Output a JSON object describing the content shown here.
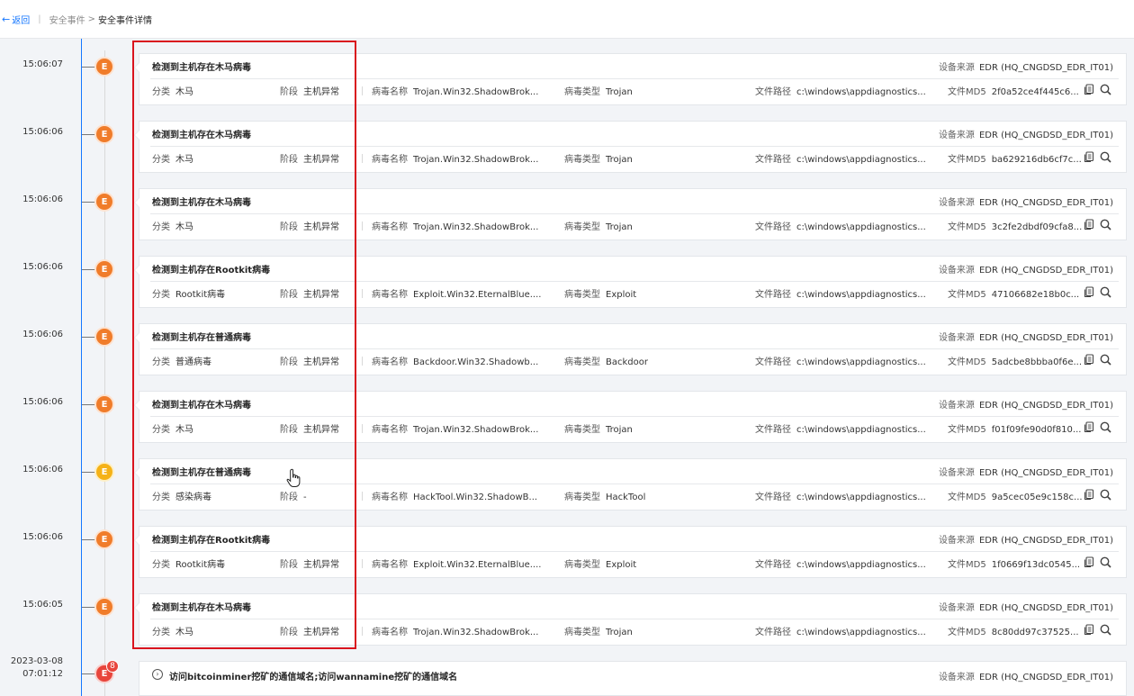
{
  "header": {
    "back_label": "返回",
    "crumb_parent": "安全事件",
    "crumb_current": "安全事件详情"
  },
  "labels": {
    "source": "设备来源",
    "category": "分类",
    "stage": "阶段",
    "virus_name": "病毒名称",
    "virus_type": "病毒类型",
    "file_path": "文件路径",
    "file_md5": "文件MD5"
  },
  "events": [
    {
      "time": "15:06:07",
      "badge": "E",
      "level": "orange",
      "title": "检测到主机存在木马病毒",
      "source": "EDR (HQ_CNGDSD_EDR_IT01)",
      "category": "木马",
      "stage": "主机异常",
      "virus_name": "Trojan.Win32.ShadowBrok...",
      "virus_type": "Trojan",
      "file_path": "c:\\windows\\appdiagnostics...",
      "md5": "2f0a52ce4f445c6..."
    },
    {
      "time": "15:06:06",
      "badge": "E",
      "level": "orange",
      "title": "检测到主机存在木马病毒",
      "source": "EDR (HQ_CNGDSD_EDR_IT01)",
      "category": "木马",
      "stage": "主机异常",
      "virus_name": "Trojan.Win32.ShadowBrok...",
      "virus_type": "Trojan",
      "file_path": "c:\\windows\\appdiagnostics...",
      "md5": "ba629216db6cf7c..."
    },
    {
      "time": "15:06:06",
      "badge": "E",
      "level": "orange",
      "title": "检测到主机存在木马病毒",
      "source": "EDR (HQ_CNGDSD_EDR_IT01)",
      "category": "木马",
      "stage": "主机异常",
      "virus_name": "Trojan.Win32.ShadowBrok...",
      "virus_type": "Trojan",
      "file_path": "c:\\windows\\appdiagnostics...",
      "md5": "3c2fe2dbdf09cfa8..."
    },
    {
      "time": "15:06:06",
      "badge": "E",
      "level": "orange",
      "title": "检测到主机存在Rootkit病毒",
      "source": "EDR (HQ_CNGDSD_EDR_IT01)",
      "category": "Rootkit病毒",
      "stage": "主机异常",
      "virus_name": "Exploit.Win32.EternalBlue....",
      "virus_type": "Exploit",
      "file_path": "c:\\windows\\appdiagnostics...",
      "md5": "47106682e18b0c..."
    },
    {
      "time": "15:06:06",
      "badge": "E",
      "level": "orange",
      "title": "检测到主机存在普通病毒",
      "source": "EDR (HQ_CNGDSD_EDR_IT01)",
      "category": "普通病毒",
      "stage": "主机异常",
      "virus_name": "Backdoor.Win32.Shadowb...",
      "virus_type": "Backdoor",
      "file_path": "c:\\windows\\appdiagnostics...",
      "md5": "5adcbe8bbba0f6e..."
    },
    {
      "time": "15:06:06",
      "badge": "E",
      "level": "orange",
      "title": "检测到主机存在木马病毒",
      "source": "EDR (HQ_CNGDSD_EDR_IT01)",
      "category": "木马",
      "stage": "主机异常",
      "virus_name": "Trojan.Win32.ShadowBrok...",
      "virus_type": "Trojan",
      "file_path": "c:\\windows\\appdiagnostics...",
      "md5": "f01f09fe90d0f810..."
    },
    {
      "time": "15:06:06",
      "badge": "E",
      "level": "yellow",
      "title": "检测到主机存在普通病毒",
      "source": "EDR (HQ_CNGDSD_EDR_IT01)",
      "category": "感染病毒",
      "stage": "-",
      "virus_name": "HackTool.Win32.ShadowB...",
      "virus_type": "HackTool",
      "file_path": "c:\\windows\\appdiagnostics...",
      "md5": "9a5cec05e9c158c..."
    },
    {
      "time": "15:06:06",
      "badge": "E",
      "level": "orange",
      "title": "检测到主机存在Rootkit病毒",
      "source": "EDR (HQ_CNGDSD_EDR_IT01)",
      "category": "Rootkit病毒",
      "stage": "主机异常",
      "virus_name": "Exploit.Win32.EternalBlue....",
      "virus_type": "Exploit",
      "file_path": "c:\\windows\\appdiagnostics...",
      "md5": "1f0669f13dc0545..."
    },
    {
      "time": "15:06:05",
      "badge": "E",
      "level": "orange",
      "title": "检测到主机存在木马病毒",
      "source": "EDR (HQ_CNGDSD_EDR_IT01)",
      "category": "木马",
      "stage": "主机异常",
      "virus_name": "Trojan.Win32.ShadowBrok...",
      "virus_type": "Trojan",
      "file_path": "c:\\windows\\appdiagnostics...",
      "md5": "8c80dd97c37525..."
    }
  ],
  "last_event": {
    "date": "2023-03-08",
    "time": "07:01:12",
    "badge": "E",
    "count": "8",
    "title": "访问bitcoinminer挖矿的通信域名;访问wannamine挖矿的通信域名",
    "source": "EDR (HQ_CNGDSD_EDR_IT01)"
  },
  "icons": {
    "back": "arrow-left-icon",
    "copy": "copy-icon",
    "search": "search-icon",
    "expand": "expand-icon",
    "cursor": "hand-cursor-icon"
  }
}
